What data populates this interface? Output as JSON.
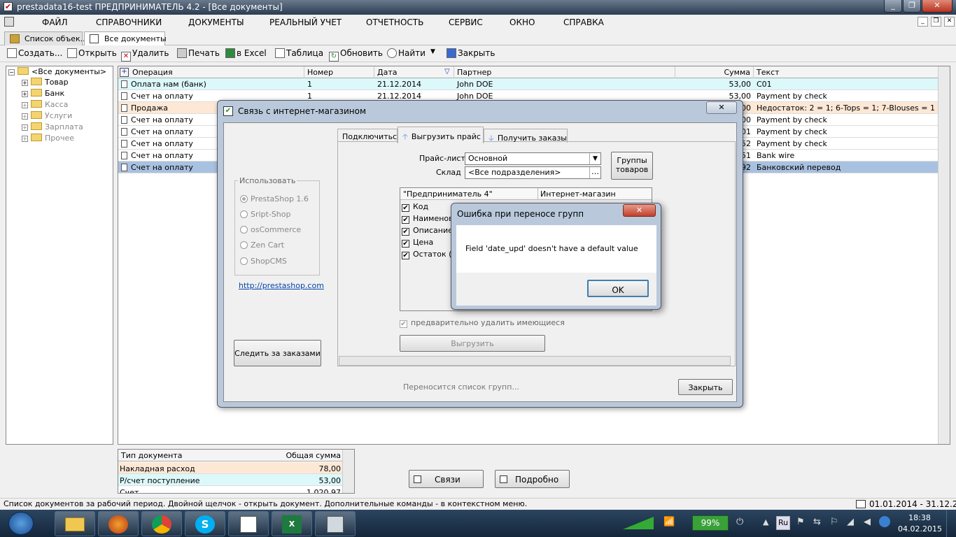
{
  "window": {
    "title": "prestadata16-test  ПРЕДПРИНИМАТЕЛЬ 4.2 - [Все документы]"
  },
  "menu": [
    "ФАЙЛ",
    "СПРАВОЧНИКИ",
    "ДОКУМЕНТЫ",
    "РЕАЛЬНЫЙ УЧЕТ",
    "ОТЧЕТНОСТЬ",
    "СЕРВИС",
    "ОКНО",
    "СПРАВКА"
  ],
  "tabs": [
    "Список объек...",
    "Все документы"
  ],
  "toolbar": {
    "create": "Создать...",
    "open": "Открыть",
    "delete": "Удалить",
    "print": "Печать",
    "excel": "в Excel",
    "table": "Таблица",
    "refresh": "Обновить",
    "find": "Найти",
    "close": "Закрыть"
  },
  "tree": {
    "root": "<Все документы>",
    "items": [
      "Товар",
      "Банк",
      "Касса",
      "Услуги",
      "Зарплата",
      "Прочее"
    ]
  },
  "grid": {
    "headers": {
      "op": "Операция",
      "num": "Номер",
      "date": "Дата",
      "partner": "Партнер",
      "sum": "Сумма",
      "text": "Текст"
    },
    "rows": [
      {
        "op": "Оплата нам (банк)",
        "num": "1",
        "date": "21.12.2014",
        "partner": "John DOE",
        "sum": "53,00",
        "text": "C01"
      },
      {
        "op": "Счет на оплату",
        "num": "1",
        "date": "21.12.2014",
        "partner": "John DOE",
        "sum": "53,00",
        "text": "Payment by check"
      },
      {
        "op": "Продажа",
        "num": "",
        "date": "",
        "partner": "",
        "sum": "00",
        "text": "Недостаток: 2 = 1; 6-Tops = 1; 7-Blouses = 1"
      },
      {
        "op": "Счет на оплату",
        "num": "",
        "date": "",
        "partner": "",
        "sum": "00",
        "text": "Payment by check"
      },
      {
        "op": "Счет на оплату",
        "num": "",
        "date": "",
        "partner": "",
        "sum": "01",
        "text": "Payment by check"
      },
      {
        "op": "Счет на оплату",
        "num": "",
        "date": "",
        "partner": "",
        "sum": "52",
        "text": "Payment by check"
      },
      {
        "op": "Счет на оплату",
        "num": "",
        "date": "",
        "partner": "",
        "sum": "51",
        "text": "Bank wire"
      },
      {
        "op": "Счет на оплату",
        "num": "",
        "date": "",
        "partner": "",
        "sum": "92",
        "text": "Банковский перевод"
      }
    ]
  },
  "summary": {
    "headers": {
      "type": "Тип документа",
      "total": "Общая сумма"
    },
    "rows": [
      {
        "type": "Накладная расход",
        "total": "78,00"
      },
      {
        "type": "Р/счет поступление",
        "total": "53,00"
      },
      {
        "type": "Счет",
        "total": "1 020,97"
      }
    ]
  },
  "bottom_buttons": {
    "links": "Связи",
    "details": "Подробно"
  },
  "statusbar": {
    "text": "Список документов за рабочий период. Двойной щелчок - открыть документ. Дополнительные команды - в контекстном меню.",
    "period": "01.01.2014 - 31.12.2015"
  },
  "shop_dialog": {
    "title": "Связь с интернет-магазином",
    "tabs": [
      "Подключиться",
      "Выгрузить прайс",
      "Получить заказы"
    ],
    "use_label": "Использовать",
    "platforms": [
      "PrestaShop 1.6",
      "Sript-Shop",
      "osCommerce",
      "Zen Cart",
      "ShopCMS"
    ],
    "link": "http://prestashop.com",
    "watch_button": "Следить за заказами",
    "pricelist_label": "Прайс-лист",
    "pricelist_value": "Основной",
    "warehouse_label": "Склад",
    "warehouse_value": "<Все подразделения>",
    "groups_button_1": "Группы",
    "groups_button_2": "товаров",
    "map_headers": {
      "left": "\"Предприниматель 4\"",
      "right": "Интернет-магазин"
    },
    "fields": [
      "Код",
      "Наименова",
      "Описание",
      "Цена",
      "Остаток (с"
    ],
    "predelete": "предварительно удалить имеющиеся",
    "export_button": "Выгрузить",
    "progress_text": "Переносится список групп...",
    "close_button": "Закрыть"
  },
  "error_dialog": {
    "title": "Ошибка при переносе групп",
    "message": "Field 'date_upd' doesn't have a default value",
    "ok": "OK"
  },
  "tray": {
    "battery": "99%",
    "lang": "Ru",
    "time": "18:38",
    "date": "04.02.2015"
  }
}
